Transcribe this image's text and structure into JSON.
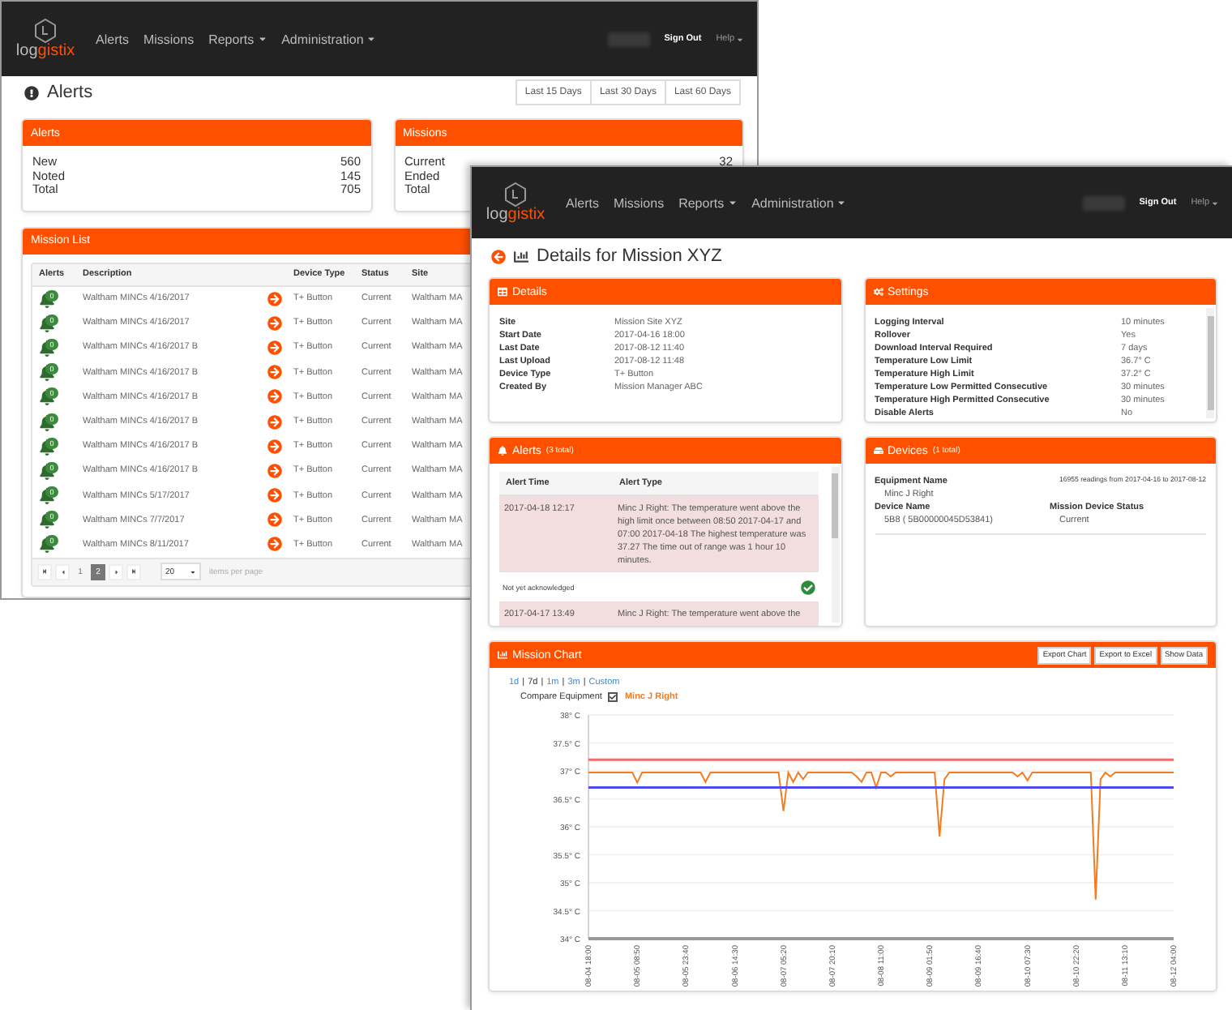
{
  "alerts_window": {
    "logo": {
      "prefix": "log",
      "suffix": "gistix"
    },
    "nav": [
      {
        "label": "Alerts",
        "dropdown": false
      },
      {
        "label": "Missions",
        "dropdown": false
      },
      {
        "label": "Reports",
        "dropdown": true
      },
      {
        "label": "Administration",
        "dropdown": true
      }
    ],
    "user_links": [
      {
        "label": "Sign Out",
        "dropdown": false
      },
      {
        "label": "Help",
        "dropdown": true
      }
    ],
    "title": "Alerts",
    "date_ranges": [
      "Last 15 Days",
      "Last 30 Days",
      "Last 60 Days"
    ],
    "summary_cards": [
      {
        "title": "Alerts",
        "rows": [
          {
            "label": "New",
            "value": "560"
          },
          {
            "label": "Noted",
            "value": "145"
          },
          {
            "label": "Total",
            "value": "705"
          }
        ]
      },
      {
        "title": "Missions",
        "rows": [
          {
            "label": "Current",
            "value": "32"
          },
          {
            "label": "Ended"
          },
          {
            "label": "Total"
          }
        ]
      }
    ],
    "mission_list": {
      "title": "Mission List",
      "columns": [
        "Alerts",
        "Description",
        "Device Type",
        "Status",
        "Site"
      ],
      "rows": [
        {
          "alerts": "0",
          "description": "Waltham MINCs 4/16/2017",
          "device_type": "T+ Button",
          "status": "Current",
          "site": "Waltham MA"
        },
        {
          "alerts": "0",
          "description": "Waltham MINCs 4/16/2017",
          "device_type": "T+ Button",
          "status": "Current",
          "site": "Waltham MA"
        },
        {
          "alerts": "0",
          "description": "Waltham MINCs 4/16/2017 B",
          "device_type": "T+ Button",
          "status": "Current",
          "site": "Waltham MA"
        },
        {
          "alerts": "0",
          "description": "Waltham MINCs 4/16/2017 B",
          "device_type": "T+ Button",
          "status": "Current",
          "site": "Waltham MA"
        },
        {
          "alerts": "0",
          "description": "Waltham MINCs 4/16/2017 B",
          "device_type": "T+ Button",
          "status": "Current",
          "site": "Waltham MA"
        },
        {
          "alerts": "0",
          "description": "Waltham MINCs 4/16/2017 B",
          "device_type": "T+ Button",
          "status": "Current",
          "site": "Waltham MA"
        },
        {
          "alerts": "0",
          "description": "Waltham MINCs 4/16/2017 B",
          "device_type": "T+ Button",
          "status": "Current",
          "site": "Waltham MA"
        },
        {
          "alerts": "0",
          "description": "Waltham MINCs 4/16/2017 B",
          "device_type": "T+ Button",
          "status": "Current",
          "site": "Waltham MA"
        },
        {
          "alerts": "0",
          "description": "Waltham MINCs 5/17/2017",
          "device_type": "T+ Button",
          "status": "Current",
          "site": "Waltham MA"
        },
        {
          "alerts": "0",
          "description": "Waltham MINCs 7/7/2017",
          "device_type": "T+ Button",
          "status": "Current",
          "site": "Waltham MA"
        },
        {
          "alerts": "0",
          "description": "Waltham MINCs 8/11/2017",
          "device_type": "T+ Button",
          "status": "Current",
          "site": "Waltham MA"
        }
      ],
      "pagination": {
        "pages": [
          {
            "label": "1",
            "selected": false
          },
          {
            "label": "2",
            "selected": true
          }
        ],
        "page_size": "20",
        "page_size_label": "items per page"
      }
    }
  },
  "mission_window": {
    "logo": {
      "prefix": "log",
      "suffix": "gistix"
    },
    "nav": [
      {
        "label": "Alerts",
        "dropdown": false
      },
      {
        "label": "Missions",
        "dropdown": false
      },
      {
        "label": "Reports",
        "dropdown": true
      },
      {
        "label": "Administration",
        "dropdown": true
      }
    ],
    "user_links": [
      {
        "label": "Sign Out",
        "dropdown": false
      },
      {
        "label": "Help",
        "dropdown": true
      }
    ],
    "title": "Details for Mission XYZ",
    "details": {
      "title": "Details",
      "rows": [
        {
          "label": "Site",
          "value": "Mission Site XYZ"
        },
        {
          "label": "Start Date",
          "value": "2017-04-16 18:00"
        },
        {
          "label": "Last Date",
          "value": "2017-08-12 11:40"
        },
        {
          "label": "Last Upload",
          "value": "2017-08-12 11:48"
        },
        {
          "label": "Device Type",
          "value": "T+ Button"
        },
        {
          "label": "Created By",
          "value": "Mission Manager ABC"
        }
      ]
    },
    "settings": {
      "title": "Settings",
      "rows": [
        {
          "label": "Logging Interval",
          "value": "10 minutes"
        },
        {
          "label": "Rollover",
          "value": "Yes"
        },
        {
          "label": "Download Interval Required",
          "value": "7 days"
        },
        {
          "label": "Temperature Low Limit",
          "value": "36.7° C"
        },
        {
          "label": "Temperature High Limit",
          "value": "37.2° C"
        },
        {
          "label": "Temperature Low Permitted Consecutive",
          "value": "30 minutes"
        },
        {
          "label": "Temperature High Permitted Consecutive",
          "value": "30 minutes"
        },
        {
          "label": "Disable Alerts",
          "value": "No"
        }
      ]
    },
    "alerts": {
      "title": "Alerts",
      "count": "(3 total)",
      "columns": [
        "Alert Time",
        "Alert Type"
      ],
      "rows": [
        {
          "kind": "alert",
          "time": "2017-04-18 12:17",
          "message": "Minc J Right: The temperature went above the high limit once between 08:50 2017-04-17 and 07:00 2017-04-18 The highest temperature was 37.27 The time out of range was 1 hour 10 minutes."
        },
        {
          "kind": "status",
          "status": "Not yet acknowledged"
        },
        {
          "kind": "alert",
          "time": "2017-04-17 13:49",
          "message": "Minc J Right: The temperature went above the"
        }
      ]
    },
    "devices": {
      "title": "Devices",
      "count": "(1 total)",
      "equipment_label": "Equipment Name",
      "readings": "16955 readings from 2017-04-16 to 2017-08-12",
      "equipment": "Minc J Right",
      "device_label": "Device Name",
      "status_label": "Mission Device Status",
      "device": "5B8 ( 5B00000045D53841)",
      "status": "Current"
    },
    "chart": {
      "title": "Mission Chart",
      "buttons": [
        "Export Chart",
        "Export to Excel",
        "Show Data"
      ],
      "ranges": [
        {
          "label": "1d",
          "selected": false
        },
        {
          "label": "7d",
          "selected": true
        },
        {
          "label": "1m",
          "selected": false
        },
        {
          "label": "3m",
          "selected": false
        },
        {
          "label": "Custom",
          "selected": false
        }
      ],
      "range_separator": "|",
      "compare": {
        "label": "Compare Equipment",
        "checked": true
      },
      "chart_data": {
        "type": "line",
        "grid": true,
        "ylim": [
          34,
          38
        ],
        "categories": [
          "08-04 18:00",
          null,
          null,
          null,
          null,
          null,
          null,
          null,
          null,
          null,
          "08-05 08:50",
          null,
          null,
          null,
          null,
          null,
          null,
          null,
          null,
          null,
          "08-05 23:40",
          null,
          null,
          null,
          null,
          null,
          null,
          null,
          null,
          null,
          "08-06 14:30",
          null,
          null,
          null,
          null,
          null,
          null,
          null,
          null,
          null,
          "08-07 05:20",
          null,
          null,
          null,
          null,
          null,
          null,
          null,
          null,
          null,
          "08-07 20:10",
          null,
          null,
          null,
          null,
          null,
          null,
          null,
          null,
          null,
          "08-08 11:00",
          null,
          null,
          null,
          null,
          null,
          null,
          null,
          null,
          null,
          "08-09 01:50",
          null,
          null,
          null,
          null,
          null,
          null,
          null,
          null,
          null,
          "08-09 16:40",
          null,
          null,
          null,
          null,
          null,
          null,
          null,
          null,
          null,
          "08-10 07:30",
          null,
          null,
          null,
          null,
          null,
          null,
          null,
          null,
          null,
          "08-10 22:20",
          null,
          null,
          null,
          null,
          null,
          null,
          null,
          null,
          null,
          "08-11 13:10",
          null,
          null,
          null,
          null,
          null,
          null,
          null,
          null,
          null,
          "08-12 04:00"
        ],
        "series": [
          {
            "name": "Minc J Right",
            "color": "#f47c20",
            "values": [
              36.97,
              36.97,
              36.97,
              36.97,
              36.97,
              36.97,
              36.97,
              36.97,
              36.97,
              36.97,
              36.79,
              36.97,
              36.97,
              36.97,
              36.97,
              36.97,
              36.97,
              36.97,
              36.97,
              36.97,
              36.97,
              36.97,
              36.97,
              36.97,
              36.8,
              36.97,
              36.97,
              36.97,
              36.97,
              36.97,
              36.97,
              36.97,
              36.97,
              36.97,
              36.97,
              36.97,
              36.97,
              36.97,
              36.97,
              36.97,
              36.28,
              36.97,
              36.8,
              36.97,
              36.85,
              36.97,
              36.97,
              36.97,
              36.97,
              36.97,
              36.97,
              36.97,
              36.97,
              36.97,
              36.97,
              36.9,
              36.8,
              36.97,
              36.97,
              36.7,
              36.97,
              36.97,
              36.9,
              36.97,
              36.97,
              36.97,
              36.97,
              36.97,
              36.97,
              36.97,
              36.97,
              36.97,
              35.83,
              36.85,
              36.97,
              36.97,
              36.97,
              36.97,
              36.97,
              36.97,
              36.97,
              36.97,
              36.97,
              36.97,
              36.97,
              36.97,
              36.97,
              36.97,
              36.9,
              36.97,
              36.83,
              36.97,
              36.97,
              36.97,
              36.97,
              36.97,
              36.97,
              36.97,
              36.97,
              36.97,
              36.97,
              36.97,
              36.97,
              36.97,
              34.7,
              36.85,
              36.97,
              36.9,
              36.97,
              36.97,
              36.97,
              36.97,
              36.97,
              36.97,
              36.97,
              36.97,
              36.97,
              36.97,
              36.97,
              36.97,
              36.97
            ]
          },
          {
            "color": "#f26b6b",
            "values": [
              37.2,
              37.2,
              37.2,
              37.2,
              37.2,
              37.2,
              37.2,
              37.2,
              37.2,
              37.2,
              37.2,
              37.2,
              37.2,
              37.2,
              37.2,
              37.2,
              37.2,
              37.2,
              37.2,
              37.2,
              37.2,
              37.2,
              37.2,
              37.2,
              37.2,
              37.2,
              37.2,
              37.2,
              37.2,
              37.2,
              37.2,
              37.2,
              37.2,
              37.2,
              37.2,
              37.2,
              37.2,
              37.2,
              37.2,
              37.2,
              37.2,
              37.2,
              37.2,
              37.2,
              37.2,
              37.2,
              37.2,
              37.2,
              37.2,
              37.2,
              37.2,
              37.2,
              37.2,
              37.2,
              37.2,
              37.2,
              37.2,
              37.2,
              37.2,
              37.2,
              37.2,
              37.2,
              37.2,
              37.2,
              37.2,
              37.2,
              37.2,
              37.2,
              37.2,
              37.2,
              37.2,
              37.2,
              37.2,
              37.2,
              37.2,
              37.2,
              37.2,
              37.2,
              37.2,
              37.2,
              37.2,
              37.2,
              37.2,
              37.2,
              37.2,
              37.2,
              37.2,
              37.2,
              37.2,
              37.2,
              37.2,
              37.2,
              37.2,
              37.2,
              37.2,
              37.2,
              37.2,
              37.2,
              37.2,
              37.2,
              37.2,
              37.2,
              37.2,
              37.2,
              37.2,
              37.2,
              37.2,
              37.2,
              37.2,
              37.2,
              37.2,
              37.2,
              37.2,
              37.2,
              37.2,
              37.2,
              37.2,
              37.2,
              37.2,
              37.2,
              37.2
            ]
          },
          {
            "color": "#4a4af0",
            "values": [
              36.7,
              36.7,
              36.7,
              36.7,
              36.7,
              36.7,
              36.7,
              36.7,
              36.7,
              36.7,
              36.7,
              36.7,
              36.7,
              36.7,
              36.7,
              36.7,
              36.7,
              36.7,
              36.7,
              36.7,
              36.7,
              36.7,
              36.7,
              36.7,
              36.7,
              36.7,
              36.7,
              36.7,
              36.7,
              36.7,
              36.7,
              36.7,
              36.7,
              36.7,
              36.7,
              36.7,
              36.7,
              36.7,
              36.7,
              36.7,
              36.7,
              36.7,
              36.7,
              36.7,
              36.7,
              36.7,
              36.7,
              36.7,
              36.7,
              36.7,
              36.7,
              36.7,
              36.7,
              36.7,
              36.7,
              36.7,
              36.7,
              36.7,
              36.7,
              36.7,
              36.7,
              36.7,
              36.7,
              36.7,
              36.7,
              36.7,
              36.7,
              36.7,
              36.7,
              36.7,
              36.7,
              36.7,
              36.7,
              36.7,
              36.7,
              36.7,
              36.7,
              36.7,
              36.7,
              36.7,
              36.7,
              36.7,
              36.7,
              36.7,
              36.7,
              36.7,
              36.7,
              36.7,
              36.7,
              36.7,
              36.7,
              36.7,
              36.7,
              36.7,
              36.7,
              36.7,
              36.7,
              36.7,
              36.7,
              36.7,
              36.7,
              36.7,
              36.7,
              36.7,
              36.7,
              36.7,
              36.7,
              36.7,
              36.7,
              36.7,
              36.7,
              36.7,
              36.7,
              36.7,
              36.7,
              36.7,
              36.7,
              36.7,
              36.7,
              36.7,
              36.7
            ]
          }
        ],
        "yticks": [
          {
            "value": 34,
            "label": "34° C"
          },
          {
            "value": 34.5,
            "label": "34.5° C"
          },
          {
            "value": 35,
            "label": "35° C"
          },
          {
            "value": 35.5,
            "label": "35.5° C"
          },
          {
            "value": 36,
            "label": "36° C"
          },
          {
            "value": 36.5,
            "label": "36.5° C"
          },
          {
            "value": 37,
            "label": "37° C"
          },
          {
            "value": 37.5,
            "label": "37.5° C"
          },
          {
            "value": 38,
            "label": "38° C"
          }
        ]
      }
    }
  }
}
